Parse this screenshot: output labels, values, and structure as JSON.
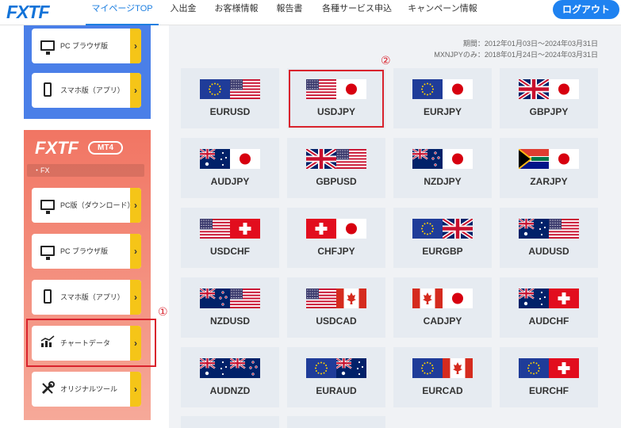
{
  "header": {
    "logo": "FXTF",
    "nav": [
      "マイページTOP",
      "入出金",
      "お客様情報",
      "報告書",
      "各種サービス申込",
      "キャンペーン情報"
    ],
    "logout": "ログアウト"
  },
  "sidebar": {
    "blue_buttons": [
      "PC ブラウザ版",
      "スマホ版（アプリ）"
    ],
    "mt4_section": {
      "logo": "FXTF",
      "badge": "MT4",
      "sub": "・FX",
      "buttons": [
        "PC版（ダウンロード）",
        "PC ブラウザ版",
        "スマホ版（アプリ）",
        "チャートデータ",
        "オリジナルツール"
      ]
    },
    "arrow": "›"
  },
  "period": {
    "line1": "期間：2012年01月03日～2024年03月31日",
    "line2": "MXNJPYのみ：2018年01月24日～2024年03月31日"
  },
  "markers": [
    "①",
    "②"
  ],
  "pairs": [
    "EURUSD",
    "USDJPY",
    "EURJPY",
    "GBPJPY",
    "AUDJPY",
    "GBPUSD",
    "NZDJPY",
    "ZARJPY",
    "USDCHF",
    "CHFJPY",
    "EURGBP",
    "AUDUSD",
    "NZDUSD",
    "USDCAD",
    "CADJPY",
    "AUDCHF",
    "AUDNZD",
    "EURAUD",
    "EURCAD",
    "EURCHF"
  ],
  "colors": {
    "brand": "#1273d8",
    "accent": "#1f82f0",
    "highlight": "#d9232d",
    "arrow": "#f5c518"
  },
  "icons": [
    "monitor-icon",
    "smartphone-icon",
    "chart-icon",
    "tools-icon",
    "flag-icon"
  ]
}
